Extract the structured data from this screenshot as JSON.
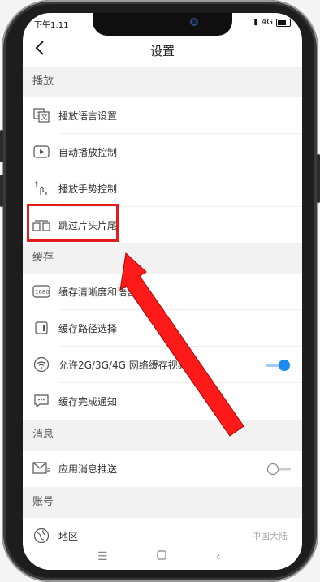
{
  "status": {
    "time": "下午1:11",
    "network": "4G"
  },
  "header": {
    "title": "设置",
    "back_icon": "chevron-left-icon"
  },
  "sections": {
    "playback": {
      "title": "播放",
      "items": [
        {
          "label": "播放语言设置",
          "icon": "language-icon"
        },
        {
          "label": "自动播放控制",
          "icon": "play-icon"
        },
        {
          "label": "播放手势控制",
          "icon": "gesture-icon"
        },
        {
          "label": "跳过片头片尾",
          "icon": "skip-icon"
        }
      ]
    },
    "cache": {
      "title": "缓存",
      "items": [
        {
          "label": "缓存清晰度和语言",
          "icon": "resolution-1080-icon",
          "icon_text": "1080"
        },
        {
          "label": "缓存路径选择",
          "icon": "folder-path-icon"
        },
        {
          "label": "允许2G/3G/4G 网络缓存视频",
          "icon": "wifi-icon",
          "toggle": true
        },
        {
          "label": "缓存完成通知",
          "icon": "chat-bubble-icon"
        }
      ]
    },
    "messages": {
      "title": "消息",
      "items": [
        {
          "label": "应用消息推送",
          "icon": "mail-icon",
          "toggle": false
        }
      ]
    },
    "account": {
      "title": "账号",
      "items": [
        {
          "label": "地区",
          "icon": "globe-icon",
          "value": "中国大陆"
        }
      ]
    }
  },
  "colors": {
    "accent": "#1a8cf0",
    "highlight": "#e11d1d",
    "arrow": "#ff1a1a"
  }
}
